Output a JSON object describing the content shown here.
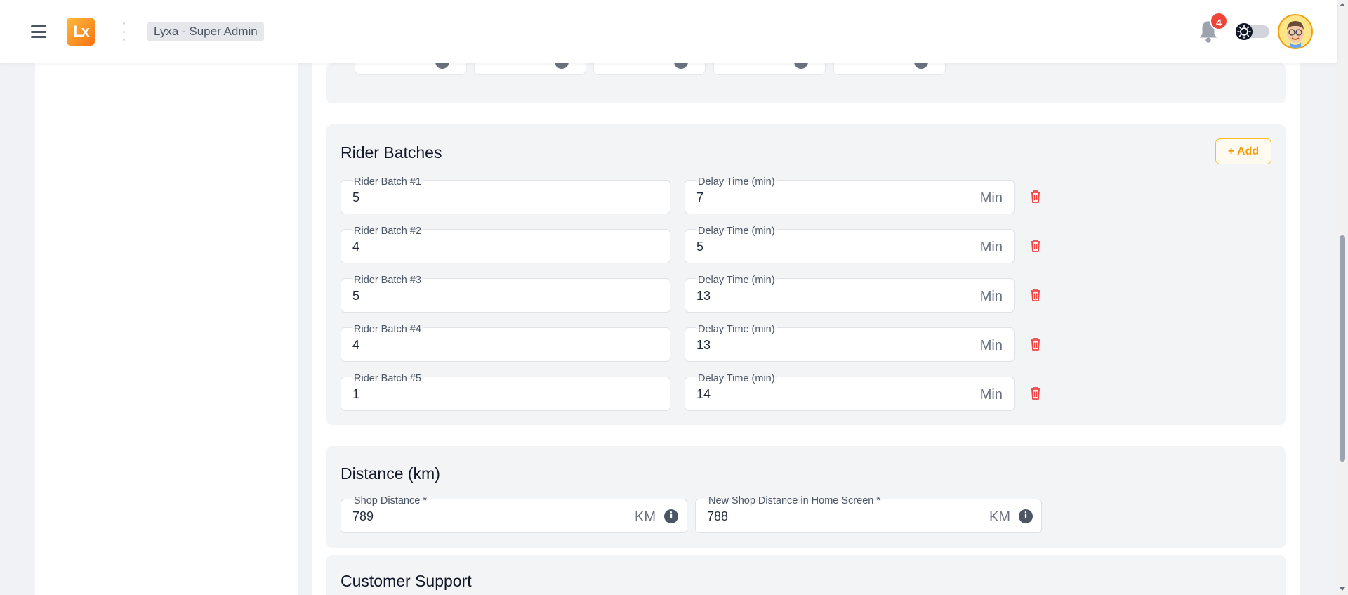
{
  "header": {
    "logo_text": "Lx",
    "role_label": "Lyxa - Super Admin",
    "notification_count": "4"
  },
  "rider_batches": {
    "title": "Rider Batches",
    "add_label": "+ Add",
    "rows": [
      {
        "batch_label": "Rider Batch #1",
        "batch_value": "5",
        "delay_label": "Delay Time (min)",
        "delay_value": "7",
        "unit": "Min"
      },
      {
        "batch_label": "Rider Batch #2",
        "batch_value": "4",
        "delay_label": "Delay Time (min)",
        "delay_value": "5",
        "unit": "Min"
      },
      {
        "batch_label": "Rider Batch #3",
        "batch_value": "5",
        "delay_label": "Delay Time (min)",
        "delay_value": "13",
        "unit": "Min"
      },
      {
        "batch_label": "Rider Batch #4",
        "batch_value": "4",
        "delay_label": "Delay Time (min)",
        "delay_value": "13",
        "unit": "Min"
      },
      {
        "batch_label": "Rider Batch #5",
        "batch_value": "1",
        "delay_label": "Delay Time (min)",
        "delay_value": "14",
        "unit": "Min"
      }
    ]
  },
  "distance": {
    "title": "Distance (km)",
    "shop_distance_label": "Shop Distance *",
    "shop_distance_value": "789",
    "new_shop_distance_label": "New Shop Distance in Home Screen *",
    "new_shop_distance_value": "788",
    "unit": "KM",
    "info_glyph": "i"
  },
  "customer_support": {
    "title": "Customer Support"
  },
  "colors": {
    "accent": "#f59e0b",
    "danger": "#ef4444",
    "badge": "#f04438"
  }
}
